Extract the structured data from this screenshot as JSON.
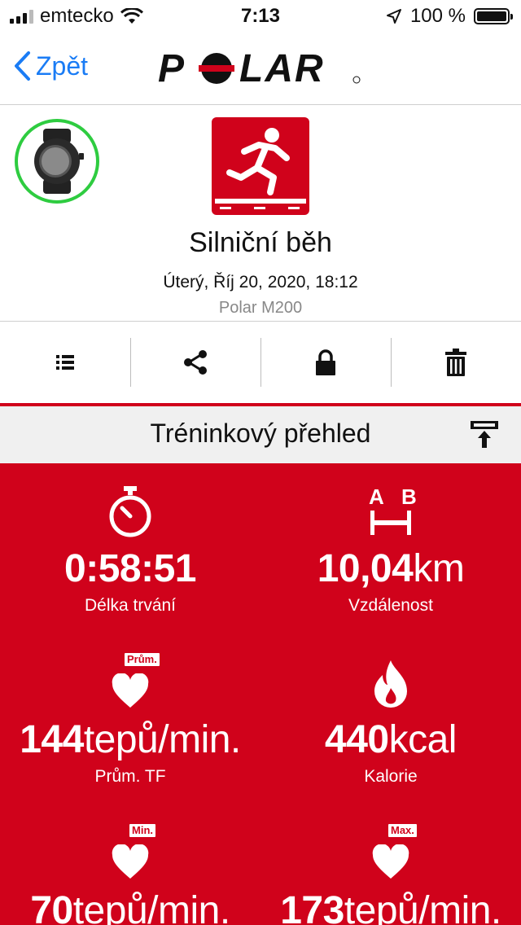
{
  "status_bar": {
    "carrier": "emtecko",
    "time": "7:13",
    "battery": "100 %"
  },
  "nav": {
    "back_label": "Zpět",
    "logo_text": "POLAR"
  },
  "session": {
    "sport": "Silniční běh",
    "datetime": "Úterý, Říj 20, 2020, 18:12",
    "device": "Polar M200"
  },
  "toolbar": {
    "icons": [
      "list-icon",
      "share-icon",
      "lock-icon",
      "trash-icon"
    ]
  },
  "section": {
    "title": "Tréninkový přehled"
  },
  "stats": {
    "duration": {
      "value": "0:58:51",
      "unit": "",
      "label": "Délka trvání"
    },
    "distance": {
      "value": "10,04",
      "unit": "km",
      "label": "Vzdálenost",
      "icon_a": "A",
      "icon_b": "B"
    },
    "avg_hr": {
      "value": "144",
      "unit": "tepů/min.",
      "label": "Prům. TF",
      "badge": "Prům."
    },
    "calories": {
      "value": "440",
      "unit": "kcal",
      "label": "Kalorie"
    },
    "min_hr": {
      "value": "70",
      "unit": "tepů/min.",
      "badge": "Min."
    },
    "max_hr": {
      "value": "173",
      "unit": "tepů/min.",
      "badge": "Max."
    }
  },
  "colors": {
    "accent": "#d0021b",
    "link": "#1a7cf5",
    "device_ring": "#2ecc40"
  }
}
